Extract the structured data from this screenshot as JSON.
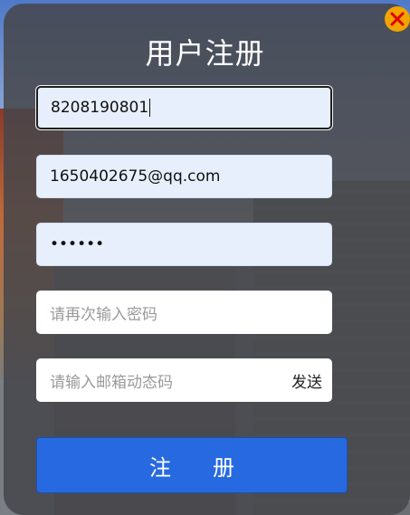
{
  "dialog": {
    "title": "用户注册",
    "close_icon": "close-icon"
  },
  "form": {
    "username": {
      "value": "8208190801"
    },
    "email": {
      "value": "1650402675@qq.com"
    },
    "password": {
      "value": "••••••"
    },
    "confirm_password": {
      "placeholder": "请再次输入密码"
    },
    "email_code": {
      "placeholder": "请输入邮箱动态码",
      "send_label": "发送"
    },
    "submit_label": "注 册"
  },
  "colors": {
    "panel": "#46464a",
    "input_filled": "#e7effd",
    "button": "#2769e0",
    "close_button": "#f2a400",
    "close_x": "#e00000"
  }
}
